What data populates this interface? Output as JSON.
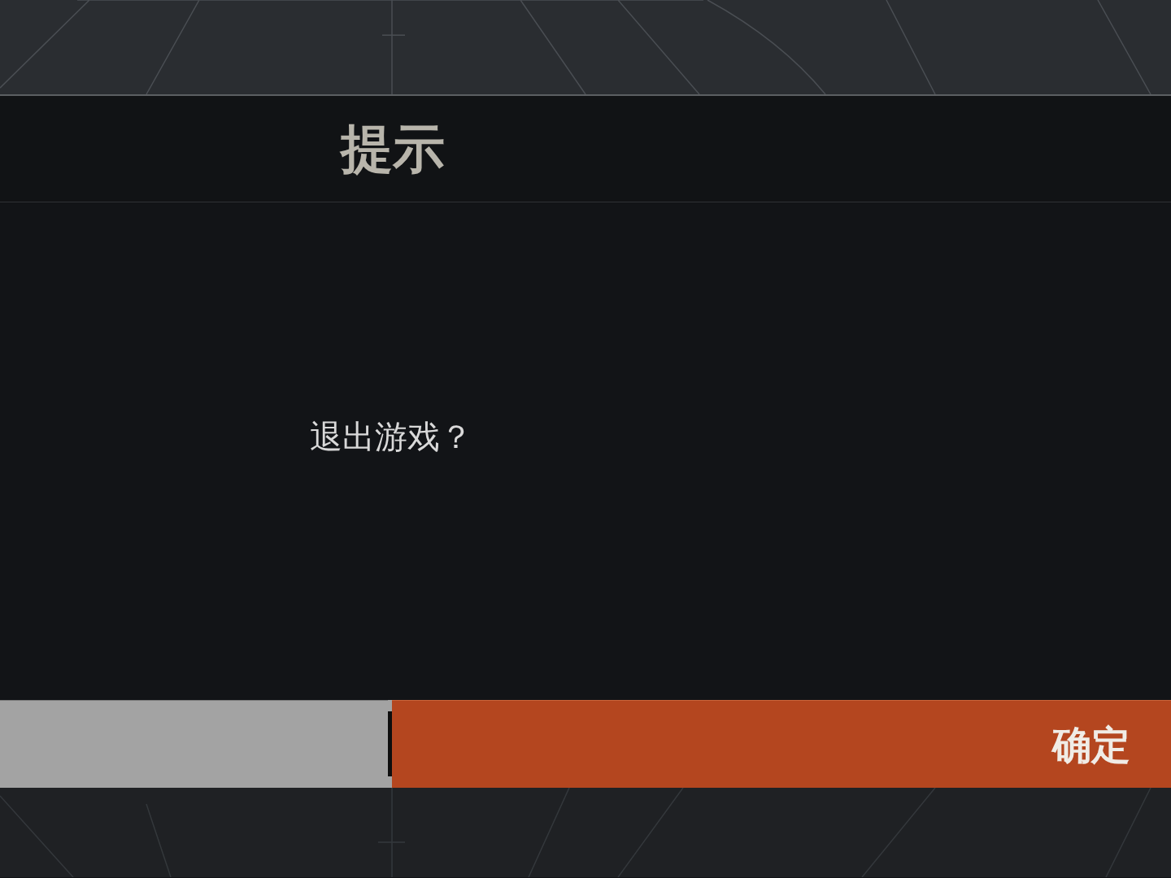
{
  "dialog": {
    "title": "提示",
    "message": "退出游戏？"
  },
  "buttons": [
    {
      "kind": "secondary"
    },
    {
      "kind": "primary",
      "label": "确定"
    }
  ]
}
